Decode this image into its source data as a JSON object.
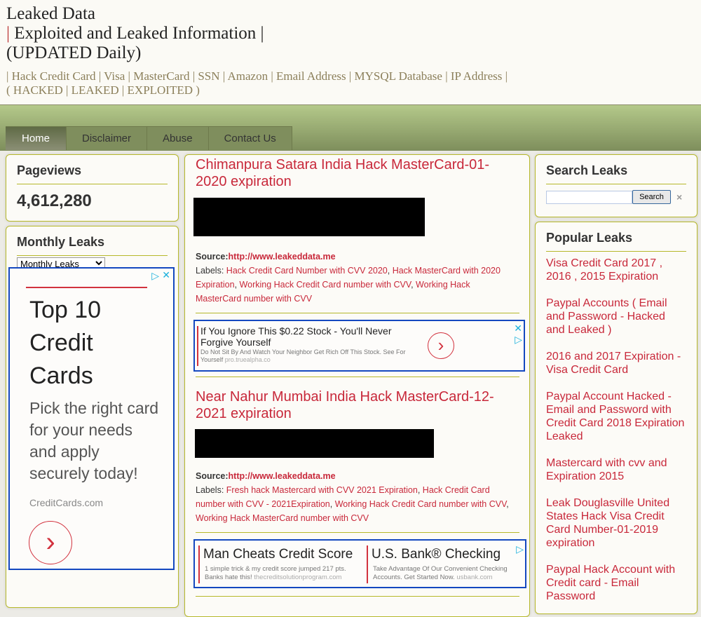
{
  "header": {
    "title_line1": "Leaked Data",
    "title_line2": "Exploited and Leaked Information",
    "title_line3": "(UPDATED Daily)",
    "description_line1": "| Hack Credit Card | Visa | MasterCard | SSN | Amazon | Email Address | MYSQL Database | IP Address |",
    "description_line2": "( HACKED | LEAKED | EXPLOITED )"
  },
  "nav": {
    "tabs": [
      {
        "label": "Home",
        "active": true
      },
      {
        "label": "Disclaimer"
      },
      {
        "label": "Abuse"
      },
      {
        "label": "Contact Us"
      }
    ]
  },
  "pageviews": {
    "title": "Pageviews",
    "count": "4,612,280"
  },
  "monthly": {
    "title": "Monthly Leaks",
    "selected": "Monthly Leaks"
  },
  "left_ad": {
    "headline": "Top 10 Credit Cards",
    "body": "Pick the right card for your needs and apply securely today!",
    "domain": "CreditCards.com"
  },
  "posts": [
    {
      "title": "Chimanpura Satara India Hack MasterCard-01-2020 expiration",
      "source_label": "Source:",
      "source_url": "http://www.leakeddata.me",
      "labels_label": "Labels:",
      "labels": [
        "Hack Credit Card Number with CVV 2020",
        "Hack MasterCard with 2020 Expiration",
        "Working Hack Credit Card number with CVV",
        "Working Hack MasterCard number with CVV"
      ]
    },
    {
      "title": "Near Nahur Mumbai India Hack MasterCard-12-2021 expiration",
      "source_label": "Source:",
      "source_url": "http://www.leakeddata.me",
      "labels_label": "Labels:",
      "labels": [
        "Fresh hack Mastercard with CVV 2021 Expiration",
        "Hack Credit Card number with CVV - 2021Expiration",
        "Working Hack Credit Card number with CVV",
        "Working Hack MasterCard number with CVV"
      ]
    }
  ],
  "ad1": {
    "headline": "If You Ignore This $0.22 Stock - You'll Never Forgive Yourself",
    "body": "Do Not Sit By And Watch Your Neighbor Get Rich Off This Stock. See For Yourself",
    "domain": "pro.truealpha.co"
  },
  "ad2": [
    {
      "headline": "Man Cheats Credit Score",
      "body": "1 simple trick & my credit score jumped 217 pts. Banks hate this!",
      "domain": "thecreditsolutionprogram.com"
    },
    {
      "headline": "U.S. Bank® Checking",
      "body": "Take Advantage Of Our Convenient Checking Accounts. Get Started Now.",
      "domain": "usbank.com"
    }
  ],
  "search": {
    "title": "Search Leaks",
    "button": "Search",
    "value": "",
    "clear": "×"
  },
  "popular": {
    "title": "Popular Leaks",
    "items": [
      "Visa Credit Card 2017 , 2016 , 2015 Expiration",
      "Paypal Accounts ( Email and Password - Hacked and Leaked )",
      "2016 and 2017 Expiration - Visa Credit Card",
      "Paypal Account Hacked - Email and Password with Credit Card 2018 Expiration Leaked",
      "Mastercard with cvv and Expiration 2015",
      "Leak Douglasville United States Hack Visa Credit Card Number-01-2019 expiration",
      "Paypal Hack Account with Credit card - Email Password"
    ]
  },
  "colors": {
    "accent": "#c8283a",
    "border": "#b6b82a",
    "ad_border": "#1448c0"
  }
}
